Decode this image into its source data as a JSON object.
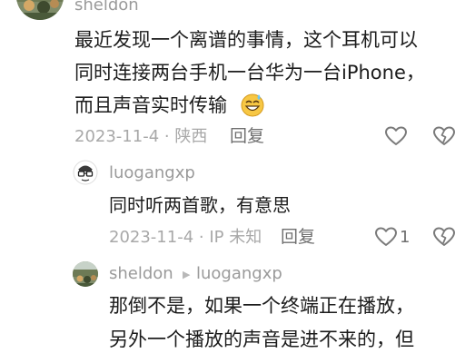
{
  "comments": [
    {
      "author": "sheldon",
      "lines": [
        "最近发现一个离谱的事情，这个耳机可以",
        "同时连接两台手机一台华为一台iPhone，",
        "而且声音实时传输"
      ],
      "emoji": "grinning-sweat-emoji",
      "date_location": "2023-11-4 · 陕西",
      "reply_label": "回复",
      "like_icon": "heart-icon",
      "dislike_icon": "broken-heart-icon"
    },
    {
      "author": "luogangxp",
      "lines": [
        "同时听两首歌，有意思"
      ],
      "date_location": "2023-11-4 · IP 未知",
      "reply_label": "回复",
      "like_count": "1",
      "like_icon": "heart-icon",
      "dislike_icon": "broken-heart-icon"
    },
    {
      "author": "sheldon",
      "reply_to": "luogangxp",
      "lines": [
        "那倒不是，如果一个终端正在播放，",
        "另外一个播放的声音是进不来的，但"
      ]
    }
  ],
  "colors": {
    "text": "#1c1c1c",
    "muted": "#a8a8a8",
    "username": "#9a9a9a",
    "icon": "#7a7a7a"
  }
}
